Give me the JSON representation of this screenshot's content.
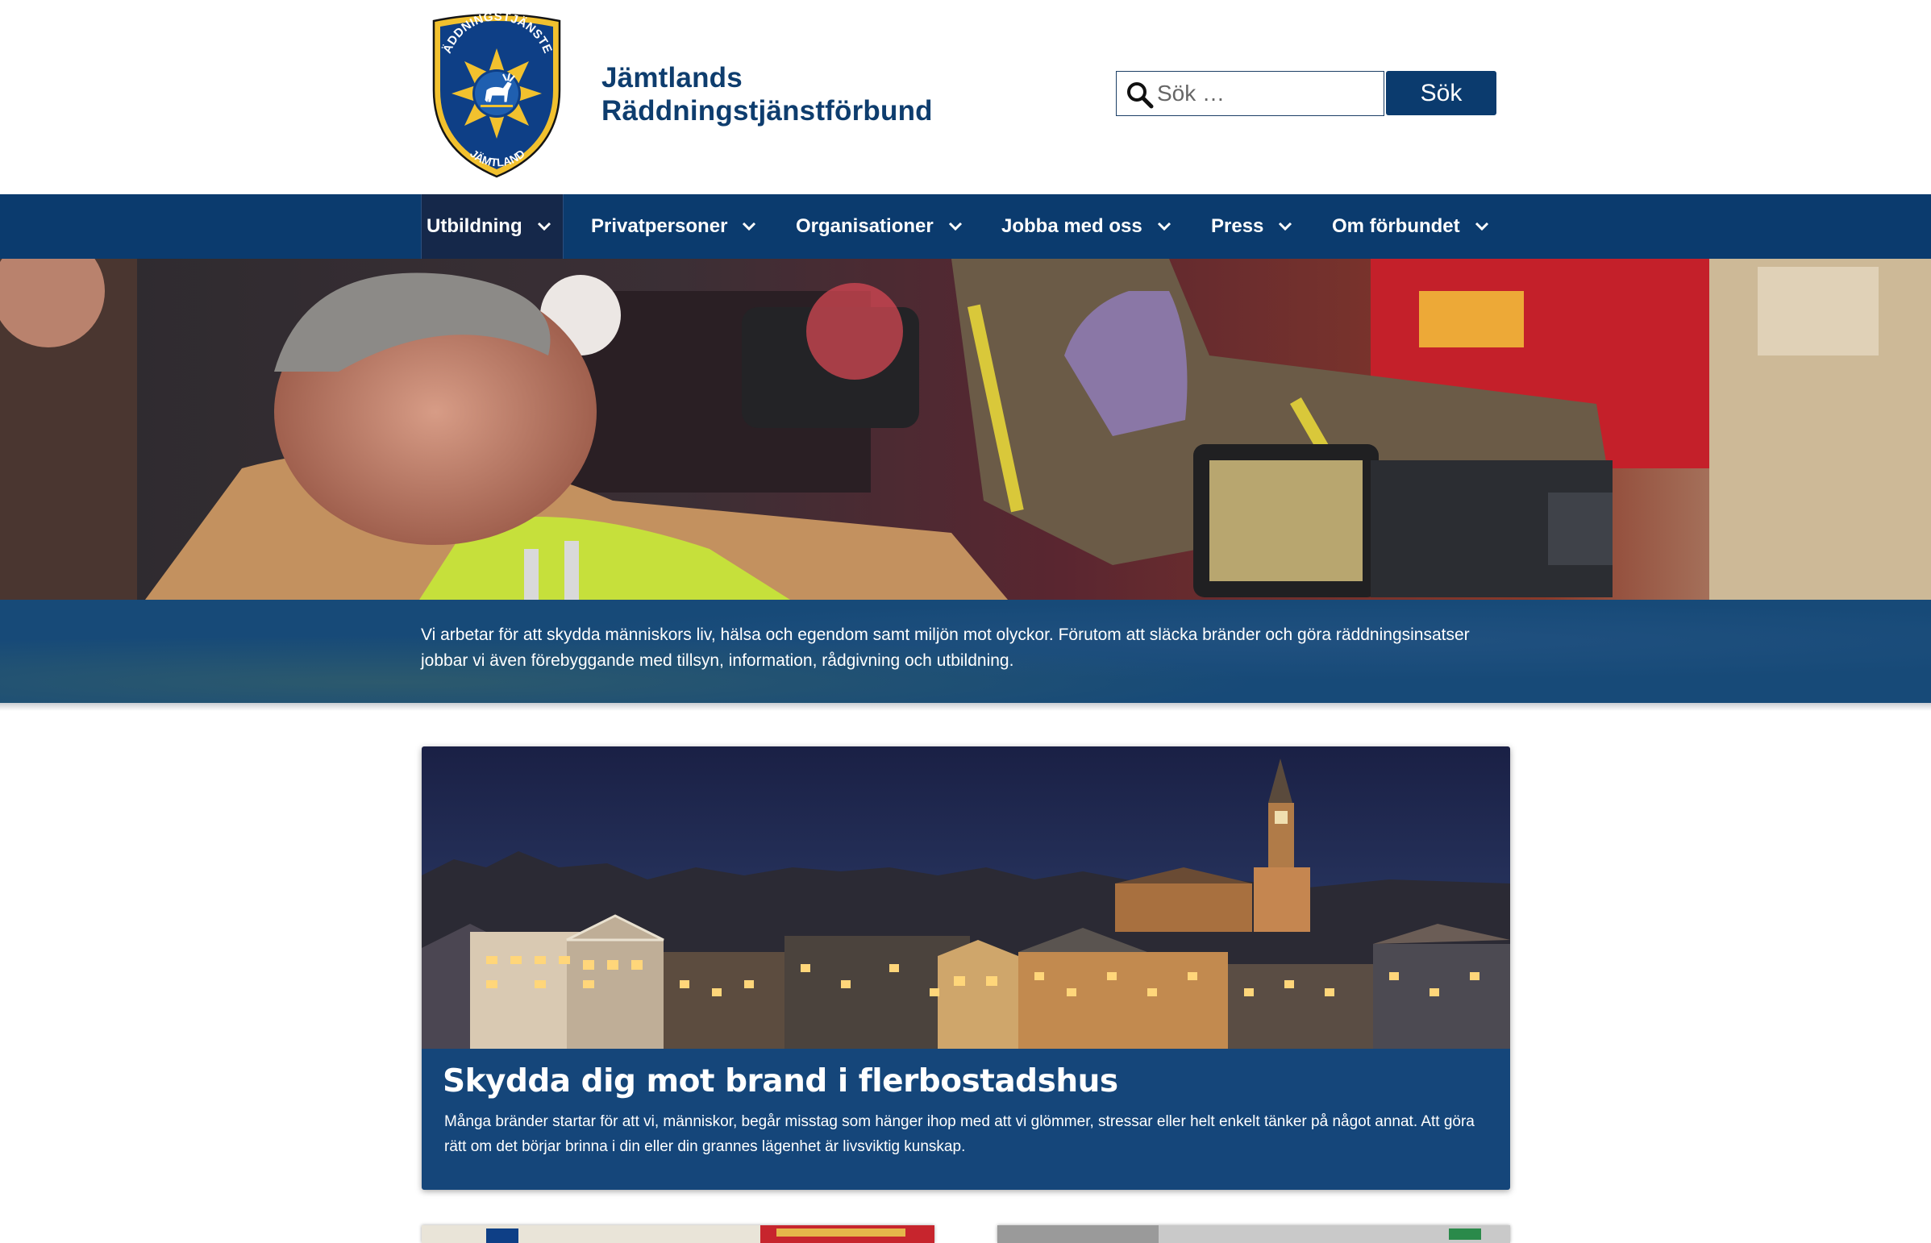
{
  "header": {
    "logo": {
      "icon": "emblem-shield-icon",
      "top_text": "RÄDDNINGSTJÄNSTEN",
      "bottom_text": "JÄMTLAND",
      "colors": {
        "shield": "#0e3f86",
        "border": "#f2c12e",
        "star": "#f2c12e"
      }
    },
    "title_line1": "Jämtlands",
    "title_line2": "Räddningstjänstförbund",
    "search": {
      "placeholder": "Sök …",
      "button_label": "Sök"
    }
  },
  "nav": {
    "items": [
      {
        "label": "Utbildning",
        "active": true
      },
      {
        "label": "Privatpersoner",
        "active": false
      },
      {
        "label": "Organisationer",
        "active": false
      },
      {
        "label": "Jobba med oss",
        "active": false
      },
      {
        "label": "Press",
        "active": false
      },
      {
        "label": "Om förbundet",
        "active": false
      }
    ]
  },
  "hero": {
    "text": "Vi arbetar för att skydda människors liv, hälsa och egendom samt miljön mot olyckor. Förutom att släcka bränder och göra räddningsinsatser jobbar vi även förebyggande med tillsyn, information, rådgivning och utbildning."
  },
  "feature": {
    "title": "Skydda dig mot brand i flerbostadshus",
    "text": "Många bränder startar för att vi, människor, begår misstag som hänger ihop med att vi glömmer, stressar eller helt enkelt tänker på något annat. Att göra rätt om det börjar brinna i din eller din grannes lägenhet är livsviktig kunskap."
  },
  "colors": {
    "primary": "#0b3b6e",
    "nav_active": "#15284a",
    "band": "#174a78"
  }
}
